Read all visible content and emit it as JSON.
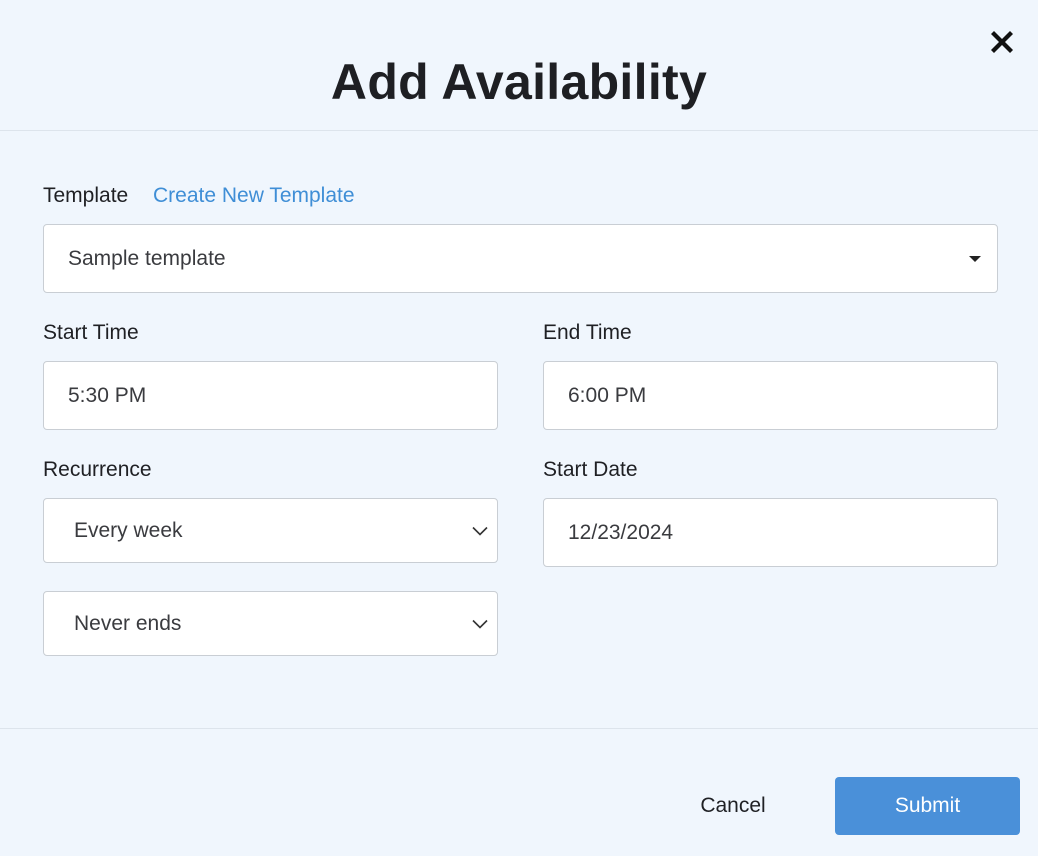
{
  "dialog": {
    "title": "Add Availability",
    "close_icon": "close-icon"
  },
  "template": {
    "label": "Template",
    "create_link": "Create New Template",
    "selected": "Sample template",
    "dropdown_icon": "caret-down-icon"
  },
  "start_time": {
    "label": "Start Time",
    "value": "5:30 PM"
  },
  "end_time": {
    "label": "End Time",
    "value": "6:00 PM"
  },
  "recurrence": {
    "label": "Recurrence",
    "selected": "Every week",
    "dropdown_icon": "chevron-down-icon"
  },
  "start_date": {
    "label": "Start Date",
    "value": "12/23/2024"
  },
  "ends": {
    "selected": "Never ends",
    "dropdown_icon": "chevron-down-icon"
  },
  "footer": {
    "cancel_label": "Cancel",
    "submit_label": "Submit"
  },
  "colors": {
    "background": "#f0f6fd",
    "accent": "#4a90d9",
    "link": "#3f8ed6",
    "divider": "#dde4ec"
  }
}
